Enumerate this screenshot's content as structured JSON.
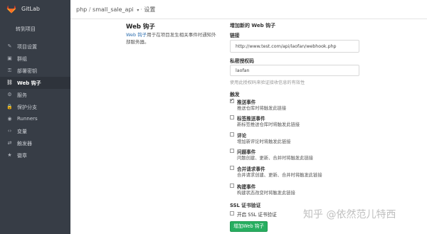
{
  "brand": {
    "name": "GitLab"
  },
  "sidebar": {
    "back_label": "转到项目",
    "items": [
      {
        "label": "项目设置",
        "icon": "edit-icon",
        "glyph": "✎"
      },
      {
        "label": "群组",
        "icon": "group-icon",
        "glyph": "▣"
      },
      {
        "label": "部署密钥",
        "icon": "key-icon",
        "glyph": "⚿"
      },
      {
        "label": "Web 钩子",
        "icon": "link-icon",
        "glyph": "⛓",
        "active": true
      },
      {
        "label": "服务",
        "icon": "cogs-icon",
        "glyph": "⚙"
      },
      {
        "label": "保护分支",
        "icon": "lock-icon",
        "glyph": "🔒"
      },
      {
        "label": "Runners",
        "icon": "github-icon",
        "glyph": "◉"
      },
      {
        "label": "变量",
        "icon": "code-icon",
        "glyph": "‹›"
      },
      {
        "label": "触发器",
        "icon": "retweet-icon",
        "glyph": "⇄"
      },
      {
        "label": "徽章",
        "icon": "star-icon",
        "glyph": "★"
      }
    ]
  },
  "header": {
    "namespace": "php",
    "project": "small_sale_api",
    "page": "设置"
  },
  "intro": {
    "title": "Web 钩子",
    "link_text": "Web 钩子",
    "desc_rest": "用于在项目发生相关事件时通知外部服务器。"
  },
  "form": {
    "heading": "增加新的 Web 钩子",
    "url_label": "链接",
    "url_value": "http://www.test.com/api/laofan/webhook.php",
    "token_label": "私密授权码",
    "token_value": "laofan",
    "token_help": "使用此授权码来验证接收信息的有效性",
    "trigger_label": "触发",
    "triggers": [
      {
        "name": "推送事件",
        "desc": "推送仓库时将触发此链接",
        "checked": true
      },
      {
        "name": "标签推送事件",
        "desc": "新标签推送仓库时将触发此链接",
        "checked": false
      },
      {
        "name": "评论",
        "desc": "增加新评论时将触发此链接",
        "checked": false
      },
      {
        "name": "问题事件",
        "desc": "问题创建、更新、合并时将触发此链接",
        "checked": false
      },
      {
        "name": "合并请求事件",
        "desc": "合并请求创建、更新、合并时将触发此链接",
        "checked": false
      },
      {
        "name": "构建事件",
        "desc": "构建状态改变时将触发此链接",
        "checked": false
      }
    ],
    "ssl_title": "SSL 证书验证",
    "ssl_option": "开启 SSL 证书验证",
    "ssl_checked": false,
    "submit_label": "增加Web 钩子"
  },
  "watermark": "知乎 @依然范儿特西",
  "colors": {
    "sidebar_bg": "#373d46",
    "accent_link": "#2c6eaf",
    "button_green": "#27ae60",
    "logo_orange": "#e24329"
  }
}
